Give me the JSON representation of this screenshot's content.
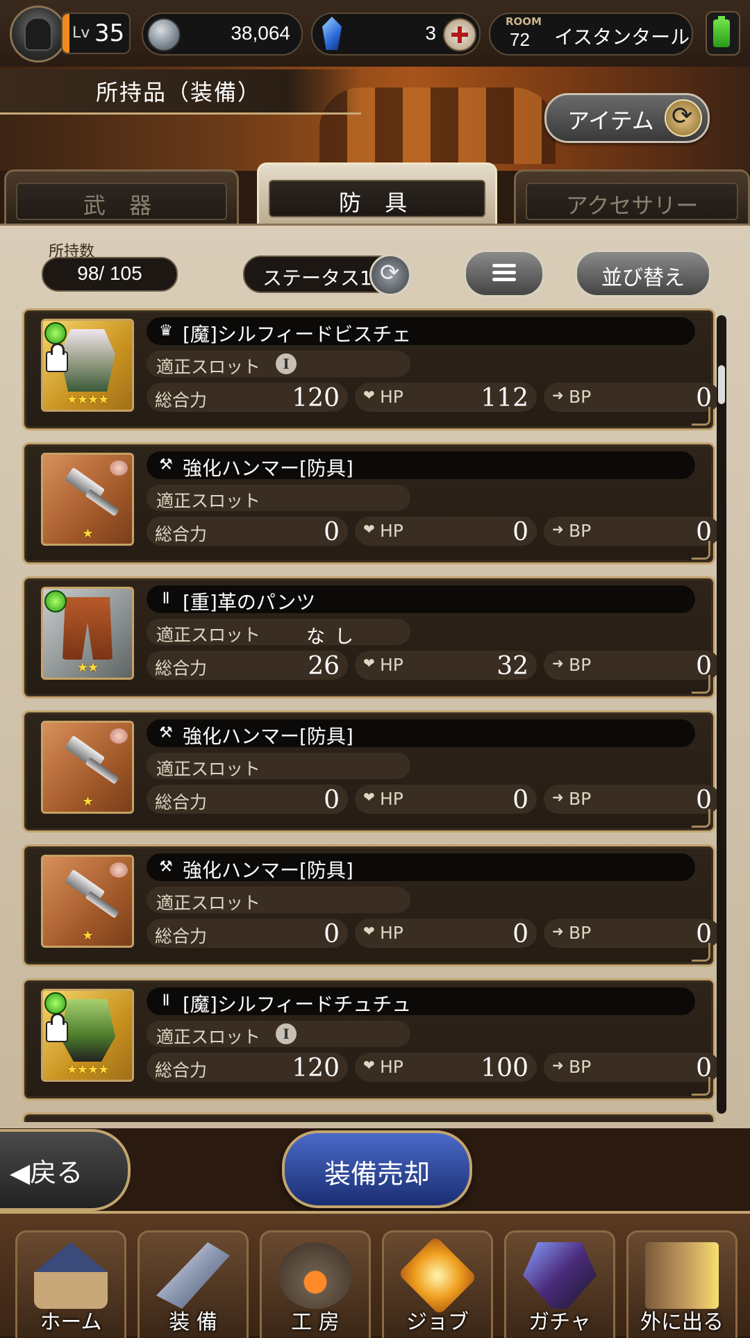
{
  "status": {
    "level_label": "Lv",
    "level": "35",
    "gil": "38,064",
    "crystals": "3",
    "room_label": "ROOM",
    "room_number": "72",
    "room_name": "イスタンタール"
  },
  "header": {
    "title": "所持品（装備）",
    "item_button": "アイテム"
  },
  "tabs": [
    {
      "label": "武 器",
      "active": false
    },
    {
      "label": "防 具",
      "active": true
    },
    {
      "label": "アクセサリー",
      "active": false
    }
  ],
  "controls": {
    "count_label": "所持数",
    "count_value": "98/ 105",
    "status_toggle": "ステータス1",
    "sort_button": "並び替え"
  },
  "stat_labels": {
    "slot": "適正スロット",
    "power": "総合力",
    "hp": "HP",
    "bp": "BP"
  },
  "items": [
    {
      "type_icon": "armor-icon",
      "name": "[魔]シルフィードビスチェ",
      "slot_roman": "I",
      "slot_text": "",
      "power": "120",
      "hp": "112",
      "bp": "0",
      "stars": "★★★★",
      "frame": "gold",
      "art": "armor",
      "locked": true,
      "gem": true
    },
    {
      "type_icon": "hammer-icon",
      "name": "強化ハンマー[防具]",
      "slot_roman": "",
      "slot_text": "",
      "power": "0",
      "hp": "0",
      "bp": "0",
      "stars": "★",
      "frame": "bronze",
      "art": "hammer",
      "locked": false,
      "gem": false
    },
    {
      "type_icon": "pants-icon",
      "name": "[重]革のパンツ",
      "slot_roman": "",
      "slot_text": "なし",
      "power": "26",
      "hp": "32",
      "bp": "0",
      "stars": "★★",
      "frame": "silver",
      "art": "pants",
      "locked": false,
      "gem": true
    },
    {
      "type_icon": "hammer-icon",
      "name": "強化ハンマー[防具]",
      "slot_roman": "",
      "slot_text": "",
      "power": "0",
      "hp": "0",
      "bp": "0",
      "stars": "★",
      "frame": "bronze",
      "art": "hammer",
      "locked": false,
      "gem": false
    },
    {
      "type_icon": "hammer-icon",
      "name": "強化ハンマー[防具]",
      "slot_roman": "",
      "slot_text": "",
      "power": "0",
      "hp": "0",
      "bp": "0",
      "stars": "★",
      "frame": "bronze",
      "art": "hammer",
      "locked": false,
      "gem": false
    },
    {
      "type_icon": "pants-icon",
      "name": "[魔]シルフィードチュチュ",
      "slot_roman": "I",
      "slot_text": "",
      "power": "120",
      "hp": "100",
      "bp": "0",
      "stars": "★★★★",
      "frame": "gold",
      "art": "skirt",
      "locked": true,
      "gem": true
    }
  ],
  "actions": {
    "back": "◀戻る",
    "sell": "装備売却"
  },
  "nav": [
    {
      "label": "ホーム",
      "art": "home"
    },
    {
      "label": "装 備",
      "art": "equip"
    },
    {
      "label": "工 房",
      "art": "craft"
    },
    {
      "label": "ジョブ",
      "art": "job"
    },
    {
      "label": "ガチャ",
      "art": "gacha"
    },
    {
      "label": "外に出る",
      "art": "out"
    }
  ]
}
